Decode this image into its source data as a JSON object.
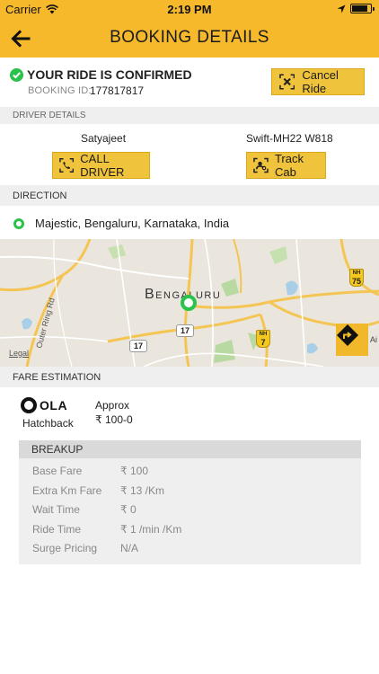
{
  "status_bar": {
    "carrier": "Carrier",
    "time": "2:19 PM",
    "battery_level": 0.9
  },
  "nav": {
    "back_icon": "arrow-left-icon",
    "title": "BOOKING DETAILS"
  },
  "confirmation": {
    "message": "YOUR RIDE IS CONFIRMED",
    "booking_id_label": "BOOKING ID:",
    "booking_id": "177817817",
    "cancel_label": "Cancel Ride"
  },
  "driver": {
    "section_label": "DRIVER DETAILS",
    "name": "Satyajeet",
    "cab_number": "Swift-MH22 W818",
    "call_label": "CALL DRIVER",
    "track_label": "Track Cab"
  },
  "direction": {
    "section_label": "DIRECTION",
    "location": "Majestic, Bengaluru, Karnataka, India"
  },
  "map": {
    "city_label": "Bengaluru",
    "road_label_outer_ring": "Outer Ring Rd",
    "legal": "Legal",
    "edge_text": "Ai",
    "badges": [
      "17",
      "17"
    ],
    "nh_badges": [
      {
        "prefix": "NH",
        "number": "75"
      },
      {
        "prefix": "NH",
        "number": "7"
      }
    ]
  },
  "fare": {
    "section_label": "FARE ESTIMATION",
    "provider": "OLA",
    "car_type": "Hatchback",
    "approx_label": "Approx",
    "approx_value": "₹ 100-0"
  },
  "breakup": {
    "header": "BREAKUP",
    "rows": [
      {
        "label": "Base Fare",
        "value": "₹ 100"
      },
      {
        "label": "Extra Km Fare",
        "value": "₹ 13 /Km"
      },
      {
        "label": "Wait Time",
        "value": "₹ 0"
      },
      {
        "label": "Ride Time",
        "value": "₹ 1 /min /Km"
      },
      {
        "label": "Surge Pricing",
        "value": "N/A"
      }
    ]
  },
  "colors": {
    "accent": "#f7b92c",
    "button": "#f0c33c",
    "confirm_green": "#29c24a",
    "section_bg": "#efefef"
  }
}
